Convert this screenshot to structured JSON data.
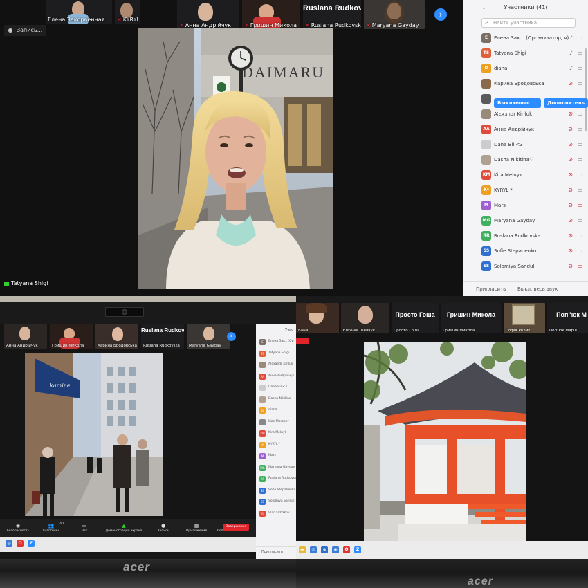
{
  "top": {
    "recording_label": "Запись...",
    "speaker_name": "Tatyana Shigi",
    "next_arrow": "›",
    "thumbnails": [
      {
        "name": "Елена Закорвенная",
        "muted": false,
        "big": ""
      },
      {
        "name": "KYRYL",
        "muted": true,
        "big": ""
      },
      {
        "name": "Анна Андрійчук",
        "muted": true,
        "big": ""
      },
      {
        "name": "Гришин Микола",
        "muted": true,
        "big": ""
      },
      {
        "name": "Ruslana Rudkovska",
        "muted": true,
        "big": "Ruslana  Rudkov"
      },
      {
        "name": "Maryana Gayday",
        "muted": true,
        "big": ""
      }
    ],
    "panel": {
      "title": "Участники (41)",
      "search_placeholder": "Найти участника",
      "hover_buttons": [
        "Выключить звук",
        "Дополнитель"
      ],
      "participants": [
        {
          "initials": "Е",
          "name": "Елена Зак...  (Организатор, я)",
          "color": "#7a6e66",
          "mic": "ok",
          "cam": "ok"
        },
        {
          "initials": "TS",
          "name": "Tatyana Shigi",
          "color": "#e0603a",
          "mic": "ok",
          "cam": "ok"
        },
        {
          "initials": "D",
          "name": "diana",
          "color": "#f0a020",
          "mic": "ok",
          "cam": "ok"
        },
        {
          "initials": "",
          "name": "Карина Бродовська",
          "color": "#8a6a4a",
          "mic": "off",
          "cam": "ok"
        },
        {
          "initials": "",
          "name": "",
          "color": "#5a5a5a",
          "mic": "",
          "cam": ""
        },
        {
          "initials": "",
          "name": "Alexandr Kirlluk",
          "color": "#9a8a7a",
          "mic": "off",
          "cam": "ok"
        },
        {
          "initials": "AA",
          "name": "Анна Андрійчук",
          "color": "#e04a3a",
          "mic": "off",
          "cam": "ok"
        },
        {
          "initials": "",
          "name": "Dana Bil <3",
          "color": "#cccccc",
          "mic": "off",
          "cam": "ok"
        },
        {
          "initials": "",
          "name": "Dasha Nikitina♡",
          "color": "#b0a090",
          "mic": "off",
          "cam": "ok"
        },
        {
          "initials": "KM",
          "name": "Kira Melnyk",
          "color": "#e04a3a",
          "mic": "off",
          "cam": "ok"
        },
        {
          "initials": "K*",
          "name": "KYRYL *",
          "color": "#f0a020",
          "mic": "off",
          "cam": "ok"
        },
        {
          "initials": "M",
          "name": "Mars",
          "color": "#a060d0",
          "mic": "off",
          "cam": "off"
        },
        {
          "initials": "MG",
          "name": "Maryana Gayday",
          "color": "#40b060",
          "mic": "off",
          "cam": "ok"
        },
        {
          "initials": "RR",
          "name": "Ruslana Rudkovska",
          "color": "#40b060",
          "mic": "off",
          "cam": "off"
        },
        {
          "initials": "SS",
          "name": "Sofie Stepanenko",
          "color": "#3070d0",
          "mic": "off",
          "cam": "off"
        },
        {
          "initials": "SS",
          "name": "Solomiya Sandul",
          "color": "#3070d0",
          "mic": "off",
          "cam": "off"
        }
      ],
      "footer_invite": "Пригласить",
      "footer_mute_all": "Выкл. весь звук"
    }
  },
  "bottom_left": {
    "thumbnails": [
      {
        "name": "Анна Андрійчук",
        "big": ""
      },
      {
        "name": "Гришин Микола",
        "big": ""
      },
      {
        "name": "Карина Бродовська",
        "big": ""
      },
      {
        "name": "Ruslana Rudkovska",
        "big": "Ruslana  Rudkov"
      },
      {
        "name": "Maryana Gayday",
        "big": ""
      }
    ],
    "shop_sign": "kamine",
    "panel_title": "Учас",
    "panel_rows": [
      {
        "initials": "Е",
        "name": "Елена Зак.. (Ор",
        "color": "#7a6e66"
      },
      {
        "initials": "TS",
        "name": "Tatyana Shigi",
        "color": "#e0603a"
      },
      {
        "initials": "",
        "name": "Alexandr Kirlluk",
        "color": "#9a8a7a"
      },
      {
        "initials": "AA",
        "name": "Анна Андрійчук",
        "color": "#e04a3a"
      },
      {
        "initials": "",
        "name": "Dana Bil <3",
        "color": "#cccccc"
      },
      {
        "initials": "",
        "name": "Dasha Nikitina",
        "color": "#b0a090"
      },
      {
        "initials": "D",
        "name": "diana",
        "color": "#f0a020"
      },
      {
        "initials": "",
        "name": "Ilian Morozov",
        "color": "#888888"
      },
      {
        "initials": "KM",
        "name": "Kira Melnyk",
        "color": "#e04a3a"
      },
      {
        "initials": "K*",
        "name": "KYRYL *",
        "color": "#f0a020"
      },
      {
        "initials": "M",
        "name": "Mars",
        "color": "#a060d0"
      },
      {
        "initials": "MG",
        "name": "Maryana Gayday",
        "color": "#40b060"
      },
      {
        "initials": "RR",
        "name": "Ruslana Rudkovska",
        "color": "#40b060"
      },
      {
        "initials": "SS",
        "name": "Sofie Stepanenko",
        "color": "#3070d0"
      },
      {
        "initials": "SS",
        "name": "Solomiya Sandul",
        "color": "#3070d0"
      },
      {
        "initials": "VU",
        "name": "Vlad Ushakov",
        "color": "#e04a3a"
      }
    ],
    "panel_footer": "Пригласить",
    "toolbar": [
      {
        "label": "Безопасность",
        "glyph": "◉"
      },
      {
        "label": "Участники",
        "glyph": "👥",
        "count": "40"
      },
      {
        "label": "Чат",
        "glyph": "▭"
      },
      {
        "label": "Демонстрация экрана",
        "glyph": "▲"
      },
      {
        "label": "Запись",
        "glyph": "●"
      },
      {
        "label": "Приложения",
        "glyph": "▦"
      },
      {
        "label": "Дополнительно",
        "glyph": "•••"
      }
    ],
    "end_button": "Завершение",
    "brand": "acer"
  },
  "bottom_right": {
    "thumbnails": [
      {
        "name": "Ваня",
        "big": ""
      },
      {
        "name": "Євгеній Шевчук",
        "big": ""
      },
      {
        "name": "Просто Гоша",
        "big": "Просто Гоша"
      },
      {
        "name": "Гришин Микола",
        "big": "Гришин Микола"
      },
      {
        "name": "Софія Ролик",
        "big": ""
      },
      {
        "name": "Поп\"юк Марія",
        "big": "Поп\"юк М"
      }
    ],
    "brand": "acer"
  }
}
